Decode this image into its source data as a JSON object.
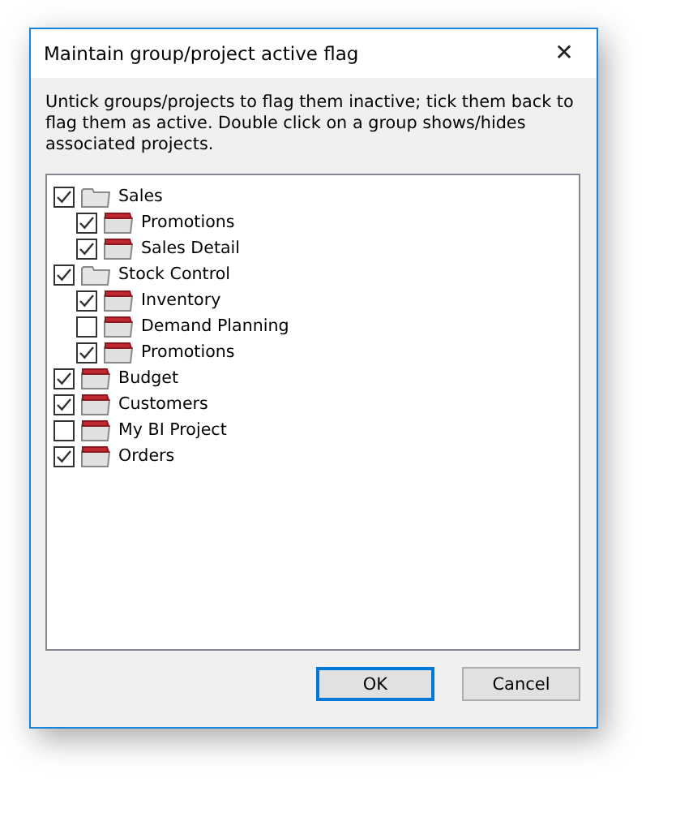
{
  "window": {
    "title": "Maintain group/project active flag",
    "close": "✕"
  },
  "instructions": "Untick groups/projects to flag them inactive; tick them back to flag them as active. Double click on a group shows/hides associated projects.",
  "tree": [
    {
      "label": "Sales",
      "kind": "group",
      "checked": true,
      "children": [
        {
          "label": "Promotions",
          "kind": "project",
          "checked": true
        },
        {
          "label": "Sales Detail",
          "kind": "project",
          "checked": true
        }
      ]
    },
    {
      "label": "Stock Control",
      "kind": "group",
      "checked": true,
      "children": [
        {
          "label": "Inventory",
          "kind": "project",
          "checked": true
        },
        {
          "label": "Demand Planning",
          "kind": "project",
          "checked": false
        },
        {
          "label": "Promotions",
          "kind": "project",
          "checked": true
        }
      ]
    },
    {
      "label": "Budget",
      "kind": "project",
      "checked": true
    },
    {
      "label": "Customers",
      "kind": "project",
      "checked": true
    },
    {
      "label": "My BI Project",
      "kind": "project",
      "checked": false
    },
    {
      "label": "Orders",
      "kind": "project",
      "checked": true
    }
  ],
  "buttons": [
    {
      "label": "OK",
      "default": true
    },
    {
      "label": "Cancel",
      "default": false
    }
  ]
}
